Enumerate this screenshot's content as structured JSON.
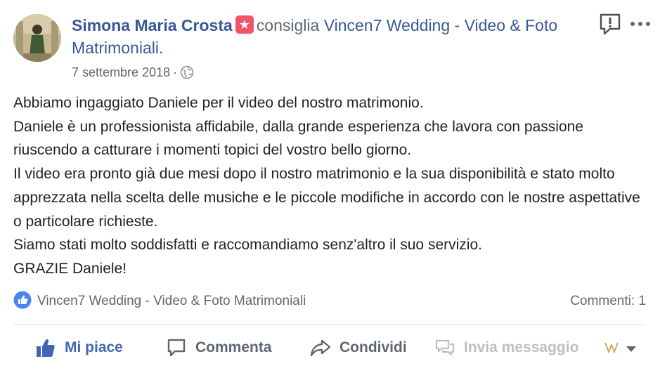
{
  "post": {
    "author": "Simona Maria Crosta",
    "action_text": "consiglia",
    "page_name": "Vincen7 Wedding - Video & Foto Matrimoniali.",
    "date": "7 settembre 2018",
    "separator": "·",
    "icons": {
      "recommend": "recommendation-badge-icon",
      "privacy": "globe-icon",
      "report": "report-icon",
      "more": "more-options-icon"
    },
    "body": [
      "Abbiamo ingaggiato Daniele per il video del nostro matrimonio.",
      "Daniele è un professionista affidabile, dalla grande esperienza che lavora con passione riuscendo a catturare i momenti topici del vostro bello giorno.",
      "Il video era pronto già due mesi dopo il nostro matrimonio e la sua disponibilità e stato molto apprezzata nella scelta delle musiche e le piccole modifiche in accordo con le nostre aspettative o particolare richieste.",
      "Siamo stati molto soddisfatti e raccomandiamo senz'altro il suo servizio.",
      "GRAZIE Daniele!"
    ]
  },
  "footer": {
    "reactions_label": "Vincen7 Wedding - Video & Foto Matrimoniali",
    "comments_count": "Commenti: 1"
  },
  "actions": {
    "like": "Mi piace",
    "comment": "Commenta",
    "share": "Condividi",
    "message": "Invia messaggio"
  },
  "colors": {
    "link": "#385898",
    "like_blue": "#4267b2",
    "badge": "#f35369",
    "muted": "#606770"
  }
}
